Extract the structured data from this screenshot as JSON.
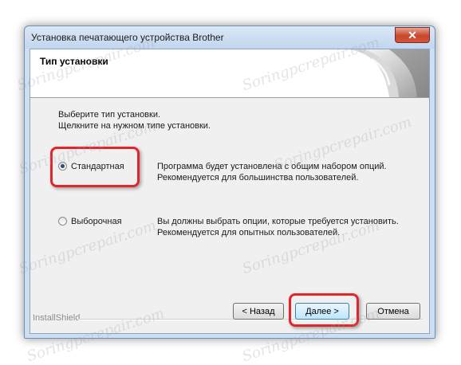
{
  "window": {
    "title": "Установка печатающего устройства Brother",
    "close_glyph": "✕"
  },
  "header": {
    "title": "Тип установки"
  },
  "instructions": {
    "line1": "Выберите тип установки.",
    "line2": "Щелкните на нужном типе установки."
  },
  "options": [
    {
      "label": "Стандартная",
      "selected": true,
      "desc1": "Программа будет установлена с общим набором опций.",
      "desc2": "Рекомендуется для большинства пользователей."
    },
    {
      "label": "Выборочная",
      "selected": false,
      "desc1": "Вы должны выбрать опции, которые требуется установить.",
      "desc2": "Рекомендуется для опытных пользователей."
    }
  ],
  "footer": {
    "brand": "InstallShield",
    "back": "< Назад",
    "next": "Далее >",
    "cancel": "Отмена"
  },
  "watermark": "Soringpcrepair.com",
  "colors": {
    "highlight": "#e0262b",
    "selected_dot": "#2b4b7c",
    "primary_button": "#bee6fd"
  }
}
